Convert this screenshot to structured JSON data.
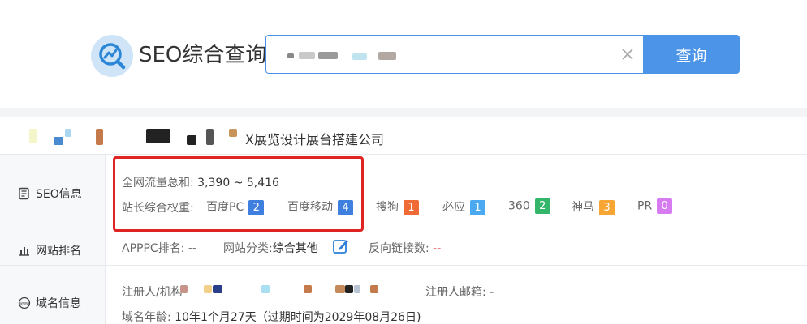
{
  "header": {
    "brand": "SEO综合查询",
    "search_value": "",
    "search_button": "查询"
  },
  "company": {
    "name": "X展览设计展台搭建公司"
  },
  "seo": {
    "label": "SEO信息",
    "traffic_label": "全网流量总和:",
    "traffic_value": "3,390 ~ 5,416",
    "weight_label": "站长综合权重:",
    "metrics": [
      {
        "name": "百度PC",
        "value": "2",
        "color": "#3f7fe0"
      },
      {
        "name": "百度移动",
        "value": "4",
        "color": "#3f7fe0"
      },
      {
        "name": "搜狗",
        "value": "1",
        "color": "#f06a35"
      },
      {
        "name": "必应",
        "value": "1",
        "color": "#4aa9f0"
      },
      {
        "name": "360",
        "value": "2",
        "color": "#33b56a"
      },
      {
        "name": "神马",
        "value": "3",
        "color": "#f7a533"
      },
      {
        "name": "PR",
        "value": "0",
        "color": "#d77cf0"
      }
    ]
  },
  "rank": {
    "label": "网站排名",
    "appc_label": "APPPC排名:",
    "appc_value": "--",
    "category_label": "网站分类:",
    "category_value": "综合其他",
    "backlinks_label": "反向链接数:",
    "backlinks_value": "--"
  },
  "domain": {
    "label": "域名信息",
    "registrant_label": "注册人/机构",
    "email_label": "注册人邮箱:",
    "email_value": "-",
    "age_label": "域名年龄:",
    "age_value": "10年1个月27天（过期时间为2029年08月26日)"
  }
}
